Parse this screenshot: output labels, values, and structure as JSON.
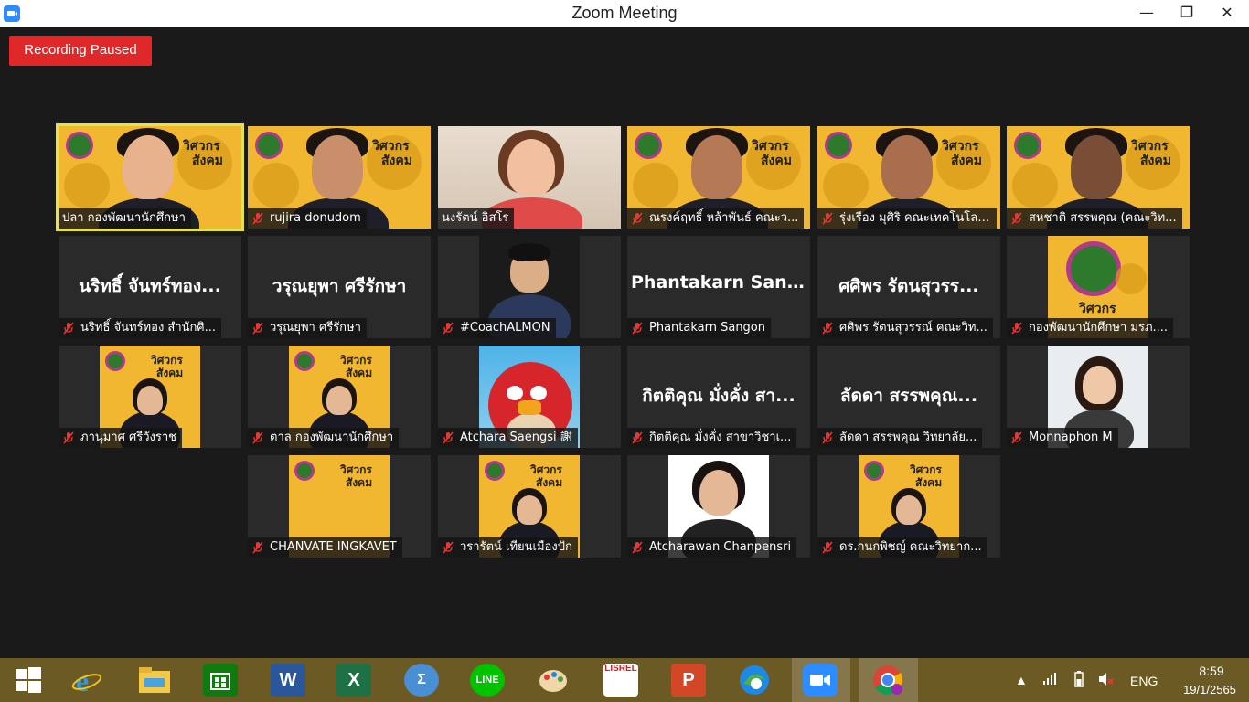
{
  "window": {
    "title": "Zoom Meeting",
    "minimize_label": "—",
    "restore_label": "❐",
    "close_label": "✕"
  },
  "recording": {
    "label": "Recording Paused"
  },
  "participants": [
    {
      "name": "ปลา กองพัฒนานักศึกษา",
      "muted": false,
      "kind": "video-yellow",
      "active": true
    },
    {
      "name": "rujira donudom",
      "muted": true,
      "kind": "video-yellow"
    },
    {
      "name": "นงรัตน์ อิสโร",
      "muted": false,
      "kind": "video-room"
    },
    {
      "name": "ณรงค์ฤทธิ์ หล้าพันธ์ คณะว...",
      "muted": true,
      "kind": "video-yellow"
    },
    {
      "name": "รุ่งเรือง มุศิริ คณะเทคโนโลย...",
      "muted": true,
      "kind": "video-yellow"
    },
    {
      "name": "สหชาติ สรรพคุณ (คณะวิท...",
      "muted": true,
      "kind": "video-yellow"
    },
    {
      "name": "นริทธิ์ จันทร์ทอง สำนักศิ...",
      "display": "นริทธิ์ จันทร์ทอง...",
      "muted": true,
      "kind": "name-only"
    },
    {
      "name": "วรุณยุพา ศรีรักษา",
      "display": "วรุณยุพา ศรีรักษา",
      "muted": true,
      "kind": "name-only"
    },
    {
      "name": "#CoachALMON",
      "muted": true,
      "kind": "photo-suit"
    },
    {
      "name": "Phantakarn Sangon",
      "display": "Phantakarn San...",
      "muted": true,
      "kind": "name-only"
    },
    {
      "name": "ศศิพร รัตนสุวรรณ์ คณะวิท...",
      "display": "ศศิพร รัตนสุวรร...",
      "muted": true,
      "kind": "name-only"
    },
    {
      "name": "กองพัฒนานักศึกษา มรภ....",
      "muted": true,
      "kind": "logo-poster"
    },
    {
      "name": "ภานุมาศ ศรีวังราช",
      "muted": true,
      "kind": "poster-person"
    },
    {
      "name": "ตาล กองพัฒนานักศึกษา",
      "muted": true,
      "kind": "poster-person"
    },
    {
      "name": "Atchara Saengsi 謝",
      "muted": true,
      "kind": "angry-bird"
    },
    {
      "name": "กิตติคุณ มั่งคั่ง สาขาวิชาเ...",
      "display": "กิตติคุณ มั่งคั่ง สา...",
      "muted": true,
      "kind": "name-only"
    },
    {
      "name": "ลัดดา สรรพคุณ วิทยาลัย...",
      "display": "ลัดดา สรรพคุณ...",
      "muted": true,
      "kind": "name-only"
    },
    {
      "name": "Monnaphon M",
      "muted": true,
      "kind": "photo-woman"
    },
    {
      "name": "CHANVATE INGKAVET",
      "muted": true,
      "kind": "poster-plain"
    },
    {
      "name": "วรารัตน์ เทียนเมืองปัก",
      "muted": true,
      "kind": "poster-person"
    },
    {
      "name": "Atcharawan Chanpensri",
      "muted": true,
      "kind": "photo-portrait"
    },
    {
      "name": "ดร.กนกพิชญ์ คณะวิทยาก...",
      "muted": true,
      "kind": "poster-person"
    }
  ],
  "poster_text": {
    "line1": "วิศวกร",
    "line2": "สังคม"
  },
  "taskbar": {
    "lang": "ENG",
    "time": "8:59",
    "date": "19/1/2565",
    "apps": [
      "start",
      "internet-explorer",
      "file-explorer",
      "store",
      "word",
      "excel",
      "math",
      "line",
      "paint",
      "lisrel",
      "powerpoint",
      "edge",
      "zoom",
      "chrome"
    ]
  },
  "colors": {
    "accent": "#2d8cff",
    "recording": "#e02828",
    "poster": "#f2b731",
    "active_border": "#e6e34a",
    "taskbar": "#6b5a24"
  }
}
